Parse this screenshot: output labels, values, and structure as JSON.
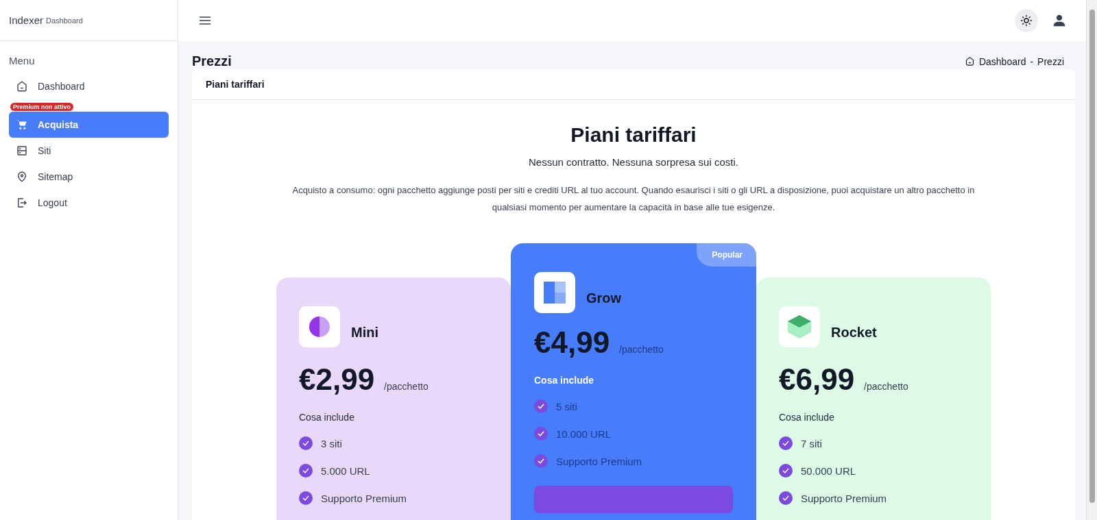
{
  "brand": {
    "name": "Indexer",
    "sub": "Dashboard"
  },
  "sidebar": {
    "heading": "Menu",
    "items": [
      {
        "label": "Dashboard",
        "selected": false
      },
      {
        "label": "Acquista",
        "selected": true,
        "badge": "Premium non attivo"
      },
      {
        "label": "Siti",
        "selected": false
      },
      {
        "label": "Sitemap",
        "selected": false
      },
      {
        "label": "Logout",
        "selected": false
      }
    ]
  },
  "page": {
    "title": "Prezzi",
    "breadcrumb": [
      "Dashboard",
      "-",
      "Prezzi"
    ]
  },
  "panel": {
    "title": "Piani tariffari",
    "heading": "Piani tariffari",
    "subtitle": "Nessun contratto. Nessuna sorpresa sui costi.",
    "description": "Acquisto a consumo: ogni pacchetto aggiunge posti per siti e crediti URL al tuo account. Quando esaurisci i siti o gli URL a disposizione, puoi acquistare un altro pacchetto in qualsiasi momento per aumentare la capacità in base alle tue esigenze."
  },
  "plans": [
    {
      "name": "Mini",
      "price": "€2,99",
      "unit": "/pacchetto",
      "includes": "Cosa include",
      "features": [
        "3 siti",
        "5.000 URL",
        "Supporto Premium"
      ],
      "color": "#ead8fb",
      "popular": false
    },
    {
      "name": "Grow",
      "price": "€4,99",
      "unit": "/pacchetto",
      "includes": "Cosa include",
      "features": [
        "5 siti",
        "10.000 URL",
        "Supporto Premium"
      ],
      "color": "#477cfb",
      "popular": true,
      "badge": "Popular"
    },
    {
      "name": "Rocket",
      "price": "€6,99",
      "unit": "/pacchetto",
      "includes": "Cosa include",
      "features": [
        "7 siti",
        "50.000 URL",
        "Supporto Premium"
      ],
      "color": "#dcfae6",
      "popular": false
    }
  ]
}
